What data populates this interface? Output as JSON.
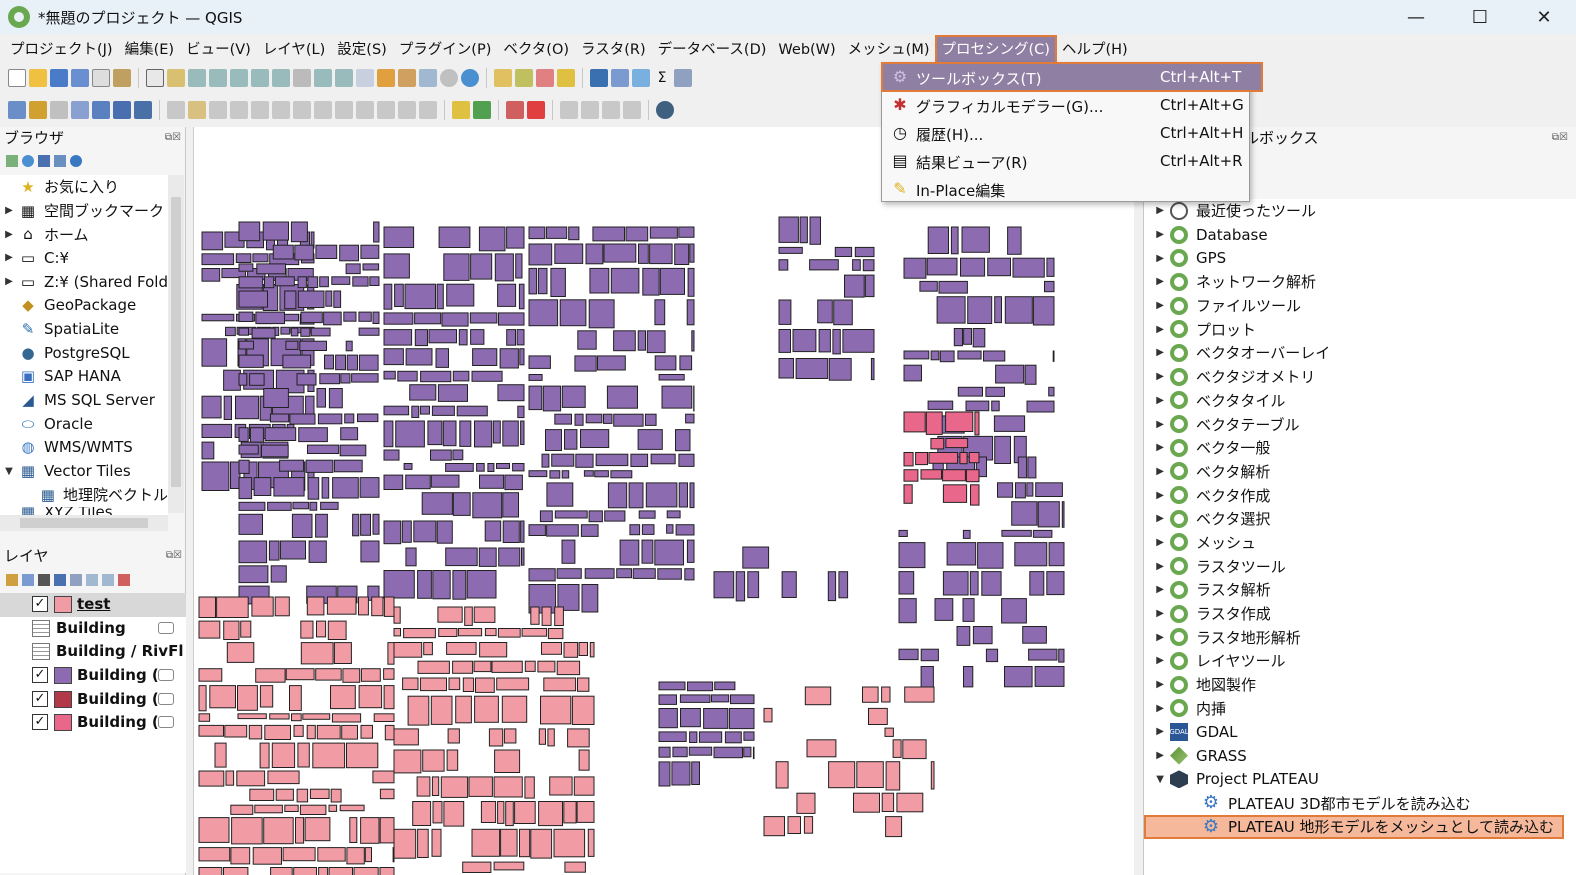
{
  "window": {
    "title": "*無題のプロジェクト — QGIS",
    "controls": {
      "minimize": "—",
      "maximize": "☐",
      "close": "✕"
    }
  },
  "menubar": {
    "items": [
      {
        "label": "プロジェクト(J)"
      },
      {
        "label": "編集(E)"
      },
      {
        "label": "ビュー(V)"
      },
      {
        "label": "レイヤ(L)"
      },
      {
        "label": "設定(S)"
      },
      {
        "label": "プラグイン(P)"
      },
      {
        "label": "ベクタ(O)"
      },
      {
        "label": "ラスタ(R)"
      },
      {
        "label": "データベース(D)"
      },
      {
        "label": "Web(W)"
      },
      {
        "label": "メッシュ(M)"
      },
      {
        "label": "プロセシング(C)"
      },
      {
        "label": "ヘルプ(H)"
      }
    ]
  },
  "processing_menu": {
    "items": [
      {
        "label": "ツールボックス(T)",
        "shortcut": "Ctrl+Alt+T",
        "icon": "gear-icon"
      },
      {
        "label": "グラフィカルモデラー(G)...",
        "shortcut": "Ctrl+Alt+G",
        "icon": "model-icon"
      },
      {
        "label": "履歴(H)...",
        "shortcut": "Ctrl+Alt+H",
        "icon": "clock-icon"
      },
      {
        "label": "結果ビューア(R)",
        "shortcut": "Ctrl+Alt+R",
        "icon": "document-icon"
      },
      {
        "label": "In-Place編集",
        "shortcut": "",
        "icon": "pencil-icon"
      }
    ]
  },
  "browser": {
    "title": "ブラウザ",
    "items": [
      {
        "label": "お気に入り",
        "icon": "star-icon"
      },
      {
        "label": "空間ブックマーク",
        "icon": "bookmark-icon"
      },
      {
        "label": "ホーム",
        "icon": "home-icon"
      },
      {
        "label": "C:¥",
        "icon": "folder-icon"
      },
      {
        "label": "Z:¥ (Shared Fold",
        "icon": "folder-icon"
      },
      {
        "label": "GeoPackage",
        "icon": "geopackage-icon"
      },
      {
        "label": "SpatiaLite",
        "icon": "spatialite-icon"
      },
      {
        "label": "PostgreSQL",
        "icon": "postgresql-icon"
      },
      {
        "label": "SAP HANA",
        "icon": "sap-hana-icon"
      },
      {
        "label": "MS SQL Server",
        "icon": "mssql-icon"
      },
      {
        "label": "Oracle",
        "icon": "oracle-icon"
      },
      {
        "label": "WMS/WMTS",
        "icon": "globe-icon"
      },
      {
        "label": "Vector Tiles",
        "icon": "grid-icon"
      },
      {
        "label": "地理院ベクトル",
        "icon": "grid-icon"
      },
      {
        "label": "XYZ Tiles",
        "icon": "grid-icon"
      }
    ]
  },
  "layers": {
    "title": "レイヤ",
    "items": [
      {
        "label": "test",
        "checked": true,
        "color": "#f19ca5"
      },
      {
        "label": "Building",
        "checked": false,
        "color": ""
      },
      {
        "label": "Building / RivFl",
        "checked": false,
        "color": ""
      },
      {
        "label": "Building (L",
        "checked": true,
        "color": "#8c6bb1"
      },
      {
        "label": "Building (L",
        "checked": true,
        "color": "#b23a48"
      },
      {
        "label": "Building (L",
        "checked": true,
        "color": "#e8678a"
      }
    ]
  },
  "toolbox": {
    "title": "ルボックス",
    "groups": [
      {
        "label": "最近使ったツール",
        "icon": "clock-icon"
      },
      {
        "label": "Database",
        "icon": "qgis-icon"
      },
      {
        "label": "GPS",
        "icon": "qgis-icon"
      },
      {
        "label": "ネットワーク解析",
        "icon": "qgis-icon"
      },
      {
        "label": "ファイルツール",
        "icon": "qgis-icon"
      },
      {
        "label": "プロット",
        "icon": "qgis-icon"
      },
      {
        "label": "ベクタオーバーレイ",
        "icon": "qgis-icon"
      },
      {
        "label": "ベクタジオメトリ",
        "icon": "qgis-icon"
      },
      {
        "label": "ベクタタイル",
        "icon": "qgis-icon"
      },
      {
        "label": "ベクタテーブル",
        "icon": "qgis-icon"
      },
      {
        "label": "ベクタ一般",
        "icon": "qgis-icon"
      },
      {
        "label": "ベクタ解析",
        "icon": "qgis-icon"
      },
      {
        "label": "ベクタ作成",
        "icon": "qgis-icon"
      },
      {
        "label": "ベクタ選択",
        "icon": "qgis-icon"
      },
      {
        "label": "メッシュ",
        "icon": "qgis-icon"
      },
      {
        "label": "ラスタツール",
        "icon": "qgis-icon"
      },
      {
        "label": "ラスタ解析",
        "icon": "qgis-icon"
      },
      {
        "label": "ラスタ作成",
        "icon": "qgis-icon"
      },
      {
        "label": "ラスタ地形解析",
        "icon": "qgis-icon"
      },
      {
        "label": "レイヤツール",
        "icon": "qgis-icon"
      },
      {
        "label": "地図製作",
        "icon": "qgis-icon"
      },
      {
        "label": "内挿",
        "icon": "qgis-icon"
      },
      {
        "label": "GDAL",
        "icon": "gdal-icon"
      },
      {
        "label": "GRASS",
        "icon": "grass-icon"
      },
      {
        "label": "Project PLATEAU",
        "icon": "plateau-icon"
      }
    ],
    "plateau_children": [
      {
        "label": "PLATEAU 3D都市モデルを読み込む"
      },
      {
        "label": "PLATEAU 地形モデルをメッシュとして読み込む"
      }
    ]
  },
  "colors": {
    "accent_highlight": "#e07b3a",
    "menu_active": "#8e7fa3",
    "building_purple": "#8c6bb1",
    "building_pink": "#f19ca5",
    "building_red": "#e8678a"
  }
}
